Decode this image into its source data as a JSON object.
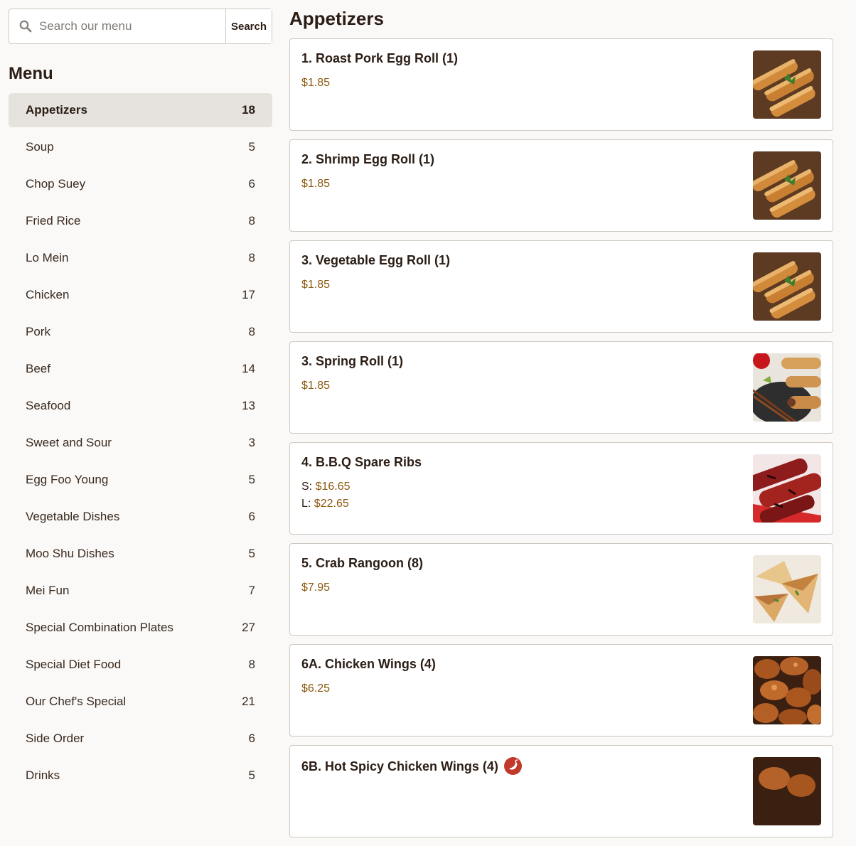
{
  "search": {
    "placeholder": "Search our menu",
    "button_label": "Search"
  },
  "menu": {
    "heading": "Menu",
    "categories": [
      {
        "label": "Appetizers",
        "count": "18"
      },
      {
        "label": "Soup",
        "count": "5"
      },
      {
        "label": "Chop Suey",
        "count": "6"
      },
      {
        "label": "Fried Rice",
        "count": "8"
      },
      {
        "label": "Lo Mein",
        "count": "8"
      },
      {
        "label": "Chicken",
        "count": "17"
      },
      {
        "label": "Pork",
        "count": "8"
      },
      {
        "label": "Beef",
        "count": "14"
      },
      {
        "label": "Seafood",
        "count": "13"
      },
      {
        "label": "Sweet and Sour",
        "count": "3"
      },
      {
        "label": "Egg Foo Young",
        "count": "5"
      },
      {
        "label": "Vegetable Dishes",
        "count": "6"
      },
      {
        "label": "Moo Shu Dishes",
        "count": "5"
      },
      {
        "label": "Mei Fun",
        "count": "7"
      },
      {
        "label": "Special Combination Plates",
        "count": "27"
      },
      {
        "label": "Special Diet Food",
        "count": "8"
      },
      {
        "label": "Our Chef's Special",
        "count": "21"
      },
      {
        "label": "Side Order",
        "count": "6"
      },
      {
        "label": "Drinks",
        "count": "5"
      }
    ]
  },
  "section": {
    "title": "Appetizers",
    "items": [
      {
        "name": "1. Roast Pork Egg Roll (1)",
        "price": "$1.85",
        "image": "egg-roll-photo"
      },
      {
        "name": "2. Shrimp Egg Roll (1)",
        "price": "$1.85",
        "image": "egg-roll-photo"
      },
      {
        "name": "3. Vegetable Egg Roll (1)",
        "price": "$1.85",
        "image": "egg-roll-photo"
      },
      {
        "name": "3. Spring Roll (1)",
        "price": "$1.85",
        "image": "spring-roll-photo"
      },
      {
        "name": "4. B.B.Q Spare Ribs",
        "size_s_label": "S:",
        "size_s_price": "$16.65",
        "size_l_label": "L:",
        "size_l_price": "$22.65",
        "image": "spare-ribs-photo"
      },
      {
        "name": "5. Crab Rangoon (8)",
        "price": "$7.95",
        "image": "crab-rangoon-photo"
      },
      {
        "name": "6A. Chicken Wings (4)",
        "price": "$6.25",
        "image": "chicken-wings-photo"
      },
      {
        "name": "6B. Hot Spicy Chicken Wings (4)",
        "image": "chicken-wings-photo",
        "badge_icon": "spicy-pepper-icon"
      }
    ]
  },
  "colors": {
    "price": "#8a5a0f",
    "active_category_bg": "#e6e3df",
    "spicy_badge": "#c0392b",
    "page_bg": "#faf9f7"
  }
}
